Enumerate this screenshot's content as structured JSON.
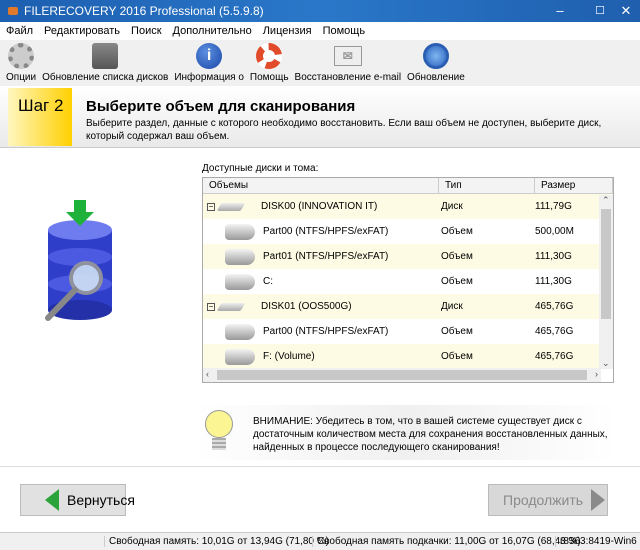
{
  "window": {
    "title": "FILERECOVERY 2016 Professional (5.5.9.8)",
    "minimize": "–",
    "maximize": "☐",
    "close": "✕"
  },
  "menu": [
    "Файл",
    "Редактировать",
    "Поиск",
    "Дополнительно",
    "Лицензия",
    "Помощь"
  ],
  "toolbar": [
    {
      "label": "Опции",
      "icon": "gear-icon"
    },
    {
      "label": "Обновление списка дисков",
      "icon": "disk-icon"
    },
    {
      "label": "Информация о",
      "icon": "info-icon"
    },
    {
      "label": "Помощь",
      "icon": "lifebuoy-icon"
    },
    {
      "label": "Восстановление e-mail",
      "icon": "envelope-icon"
    },
    {
      "label": "Обновление",
      "icon": "update-icon"
    }
  ],
  "header": {
    "step": "Шаг 2",
    "title": "Выберите объем для сканирования",
    "description": "Выберите раздел, данные с которого необходимо восстановить. Если ваш объем не доступен, выберите диск, который содержал ваш объем."
  },
  "volumes": {
    "label": "Доступные диски и тома:",
    "columns": [
      "Объемы",
      "Тип",
      "Размер"
    ],
    "rows": [
      {
        "name": "DISK00 (INNOVATION IT)",
        "type": "Диск",
        "size": "111,79G",
        "level": 0
      },
      {
        "name": "Part00 (NTFS/HPFS/exFAT)",
        "type": "Объем",
        "size": "500,00M",
        "level": 1
      },
      {
        "name": "Part01 (NTFS/HPFS/exFAT)",
        "type": "Объем",
        "size": "111,30G",
        "level": 1
      },
      {
        "name": "C:",
        "type": "Объем",
        "size": "111,30G",
        "level": 1
      },
      {
        "name": "DISK01 (OOS500G)",
        "type": "Диск",
        "size": "465,76G",
        "level": 0
      },
      {
        "name": "Part00 (NTFS/HPFS/exFAT)",
        "type": "Объем",
        "size": "465,76G",
        "level": 1
      },
      {
        "name": "F: (Volume)",
        "type": "Объем",
        "size": "465,76G",
        "level": 1
      }
    ]
  },
  "warning": "ВНИМАНИЕ: Убедитесь в том, что в вашей системе существует диск с достаточным количеством места для сохранения восстановленных данных, найденных в процессе последующего сканирования!",
  "buttons": {
    "back": "Вернуться",
    "next": "Продолжить"
  },
  "status": {
    "memory": "Свободная память: 10,01G от  13,94G (71,80 %)",
    "swap": "Свободная память подкачки: 11,00G от  16,07G (68,43 %)",
    "build": "r8363:8419-Win6"
  }
}
